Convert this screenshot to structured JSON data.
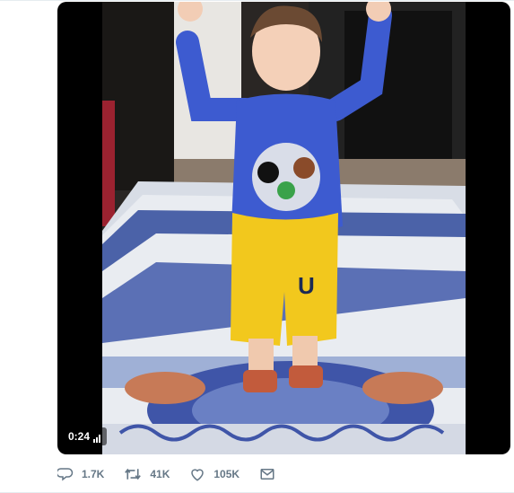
{
  "video": {
    "timestamp": "0:24",
    "frame_description_icon": "video-frame",
    "volume_icon": "signal-bars-icon"
  },
  "actions": {
    "reply": {
      "icon": "reply-icon",
      "count": "1.7K"
    },
    "retweet": {
      "icon": "retweet-icon",
      "count": "41K"
    },
    "like": {
      "icon": "heart-icon",
      "count": "105K"
    },
    "message": {
      "icon": "envelope-icon"
    }
  },
  "colors": {
    "action_gray": "#657786",
    "rug_blue": "#3f55a8",
    "shirt_blue": "#3d5bd0",
    "shorts_yellow": "#f2c81d"
  }
}
